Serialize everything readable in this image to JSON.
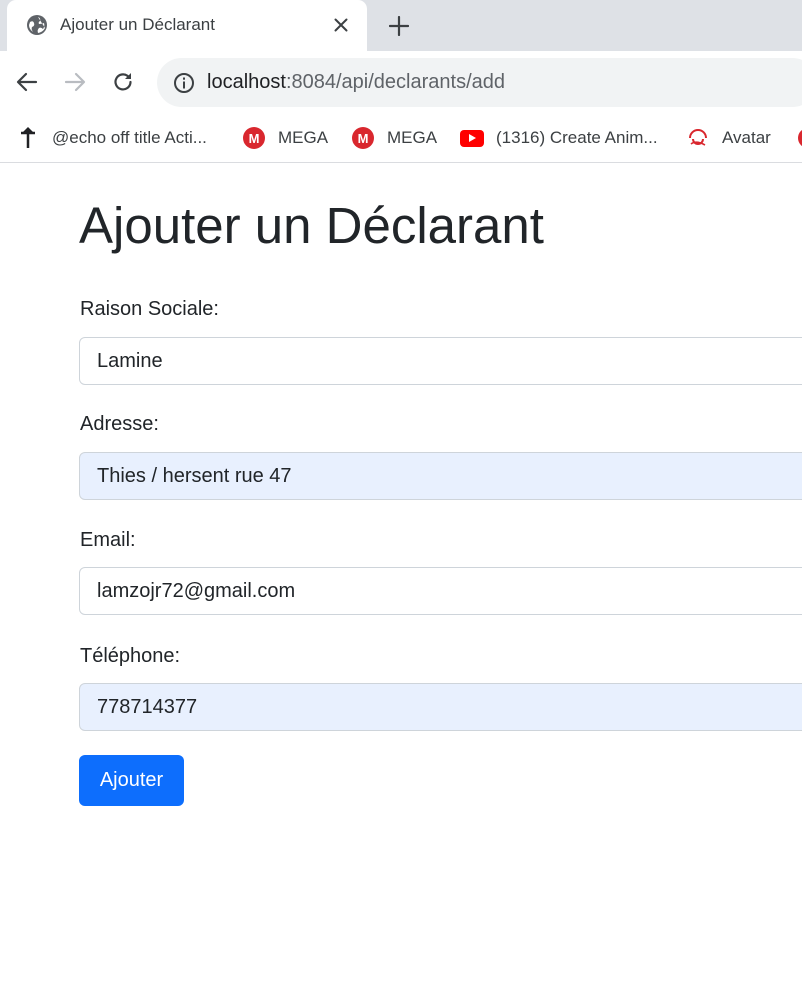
{
  "browser": {
    "tab": {
      "title": "Ajouter un Déclarant",
      "favicon": "globe-icon"
    },
    "address_bar": {
      "host": "localhost",
      "rest": ":8084/api/declarants/add"
    },
    "bookmarks": [
      {
        "label": "@echo off title Acti...",
        "icon": "arrow-up-icon"
      },
      {
        "label": "MEGA",
        "icon": "mega-icon"
      },
      {
        "label": "MEGA",
        "icon": "mega-icon"
      },
      {
        "label": "(1316) Create Anim...",
        "icon": "youtube-icon"
      },
      {
        "label": "Avatar",
        "icon": "avatar-swirl-icon"
      }
    ]
  },
  "form": {
    "title": "Ajouter un Déclarant",
    "fields": [
      {
        "label": "Raison Sociale:",
        "value": "Lamine",
        "autofilled": false
      },
      {
        "label": "Adresse:",
        "value": "Thies / hersent rue 47",
        "autofilled": true
      },
      {
        "label": "Email:",
        "value": "lamzojr72@gmail.com",
        "autofilled": false
      },
      {
        "label": "Téléphone:",
        "value": "778714377",
        "autofilled": true
      }
    ],
    "submit_label": "Ajouter"
  },
  "colors": {
    "primary": "#0d6efd",
    "autofill_bg": "#e8f0fe",
    "tabstrip": "#dee1e6",
    "mega_red": "#d9272e",
    "youtube_red": "#ff0000"
  }
}
